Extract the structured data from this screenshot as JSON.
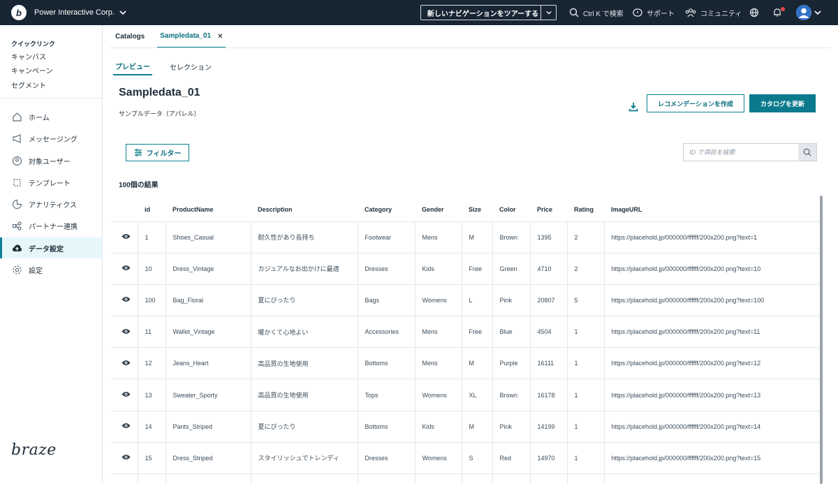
{
  "topbar": {
    "org_name": "Power Interactive Corp.",
    "tour_label": "新しいナビゲーションをツアーする",
    "search_label": "Ctrl K で検索",
    "support_label": "サポート",
    "community_label": "コミュニティ",
    "logo_letter": "b"
  },
  "sidebar": {
    "quicklinks_title": "クイックリンク",
    "quicklinks": [
      "キャンバス",
      "キャンペーン",
      "セグメント"
    ],
    "nav": [
      {
        "label": "ホーム",
        "icon": "home-icon"
      },
      {
        "label": "メッセージング",
        "icon": "megaphone-icon"
      },
      {
        "label": "対象ユーザー",
        "icon": "user-circle-icon"
      },
      {
        "label": "テンプレート",
        "icon": "template-icon"
      },
      {
        "label": "アナリティクス",
        "icon": "analytics-icon"
      },
      {
        "label": "パートナー連携",
        "icon": "partner-icon"
      },
      {
        "label": "データ設定",
        "icon": "cloud-upload-icon",
        "active": true
      },
      {
        "label": "設定",
        "icon": "gear-icon"
      }
    ],
    "brand": "braze"
  },
  "tabs": {
    "catalogs": "Catalogs",
    "current": "Sampledata_01",
    "close": "×"
  },
  "subtabs": {
    "preview": "プレビュー",
    "selection": "セレクション"
  },
  "page": {
    "title": "Sampledata_01",
    "subtitle": "サンプルデータ（アパレル）",
    "create_recommendation": "レコメンデーションを作成",
    "update_catalog": "カタログを更新",
    "filter_label": "フィルター",
    "search_placeholder": "ID で項目を検索",
    "results_count": "100個の結果"
  },
  "table": {
    "columns": [
      "",
      "id",
      "ProductName",
      "Description",
      "Category",
      "Gender",
      "Size",
      "Color",
      "Price",
      "Rating",
      "ImageURL"
    ],
    "rows": [
      [
        "1",
        "Shoes_Casual",
        "耐久性があり長持ち",
        "Footwear",
        "Mens",
        "M",
        "Brown",
        "1395",
        "2",
        "https://placehold.jp/000000/ffffff/200x200.png?text=1"
      ],
      [
        "10",
        "Dress_Vintage",
        "カジュアルなお出かけに最適",
        "Dresses",
        "Kids",
        "Free",
        "Green",
        "4710",
        "2",
        "https://placehold.jp/000000/ffffff/200x200.png?text=10"
      ],
      [
        "100",
        "Bag_Floral",
        "夏にぴったり",
        "Bags",
        "Womens",
        "L",
        "Pink",
        "20807",
        "5",
        "https://placehold.jp/000000/ffffff/200x200.png?text=100"
      ],
      [
        "11",
        "Wallet_Vintage",
        "暖かくて心地よい",
        "Accessories",
        "Mens",
        "Free",
        "Blue",
        "4504",
        "1",
        "https://placehold.jp/000000/ffffff/200x200.png?text=11"
      ],
      [
        "12",
        "Jeans_Heart",
        "高品質の生地使用",
        "Bottoms",
        "Mens",
        "M",
        "Purple",
        "16111",
        "1",
        "https://placehold.jp/000000/ffffff/200x200.png?text=12"
      ],
      [
        "13",
        "Sweater_Sporty",
        "高品質の生地使用",
        "Tops",
        "Womens",
        "XL",
        "Brown",
        "16178",
        "1",
        "https://placehold.jp/000000/ffffff/200x200.png?text=13"
      ],
      [
        "14",
        "Pants_Striped",
        "夏にぴったり",
        "Bottoms",
        "Kids",
        "M",
        "Pink",
        "14199",
        "1",
        "https://placehold.jp/000000/ffffff/200x200.png?text=14"
      ],
      [
        "15",
        "Dress_Striped",
        "スタイリッシュでトレンディ",
        "Dresses",
        "Womens",
        "S",
        "Red",
        "14970",
        "1",
        "https://placehold.jp/000000/ffffff/200x200.png?text=15"
      ],
      [
        "",
        "",
        "",
        "",
        "",
        "",
        "",
        "",
        "",
        ""
      ]
    ]
  },
  "colors": {
    "topbar": "#182533",
    "accent": "#0b8193",
    "primary_button": "#0b7a8c",
    "active_nav_bg": "#e6f7fa",
    "notification": "#e8474d"
  }
}
